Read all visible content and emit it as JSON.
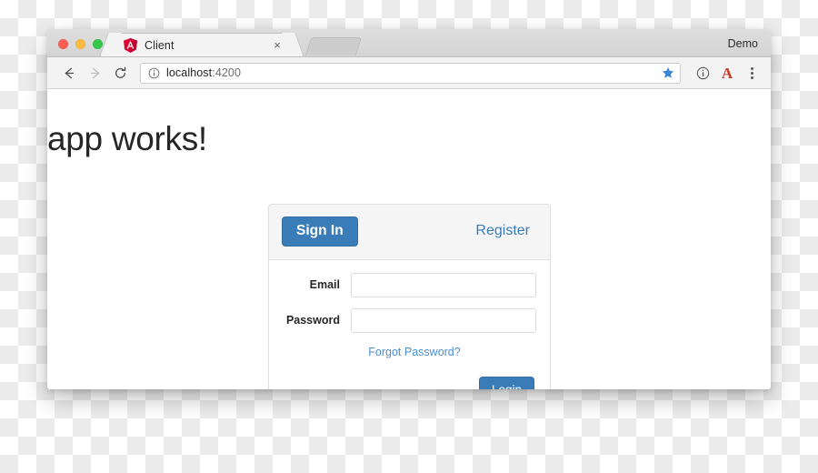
{
  "browser": {
    "window_controls": [
      {
        "name": "close",
        "color": "#fc5d55"
      },
      {
        "name": "minimize",
        "color": "#fdbc40"
      },
      {
        "name": "zoom",
        "color": "#34c749"
      }
    ],
    "tabs": [
      {
        "title": "Client",
        "favicon": "angular-logo",
        "active": true,
        "close_label": "×"
      },
      {
        "title": "",
        "favicon": "",
        "active": false,
        "close_label": ""
      }
    ],
    "profile_label": "Demo",
    "toolbar": {
      "back_icon": "back-arrow-icon",
      "forward_icon": "forward-arrow-icon",
      "reload_icon": "reload-icon",
      "site_info_icon": "info-circle-icon",
      "url_host": "localhost",
      "url_rest": ":4200",
      "url_full": "localhost:4200",
      "bookmark_icon": "star-icon",
      "bookmark_color": "#3b87d6",
      "extension_icons": [
        {
          "name": "info-circle-icon",
          "glyph": "ⓘ"
        },
        {
          "name": "adblock-a-icon",
          "glyph": "A",
          "color": "#c23b2b"
        }
      ],
      "menu_icon": "kebab-menu-icon"
    }
  },
  "page": {
    "heading": "app works!",
    "login_panel": {
      "tabs": {
        "signin_label": "Sign In",
        "register_label": "Register"
      },
      "fields": [
        {
          "label": "Email",
          "value": "",
          "placeholder": "",
          "type": "text",
          "name": "email-field"
        },
        {
          "label": "Password",
          "value": "",
          "placeholder": "",
          "type": "password",
          "name": "password-field"
        }
      ],
      "forgot_password_label": "Forgot Password?",
      "login_button_label": "Login"
    }
  },
  "colors": {
    "primary_blue": "#3a7cb8",
    "link_blue": "#4a8fd0",
    "panel_header_bg": "#f5f5f5",
    "panel_border": "#e0e0e0",
    "heading_text": "#262626"
  }
}
